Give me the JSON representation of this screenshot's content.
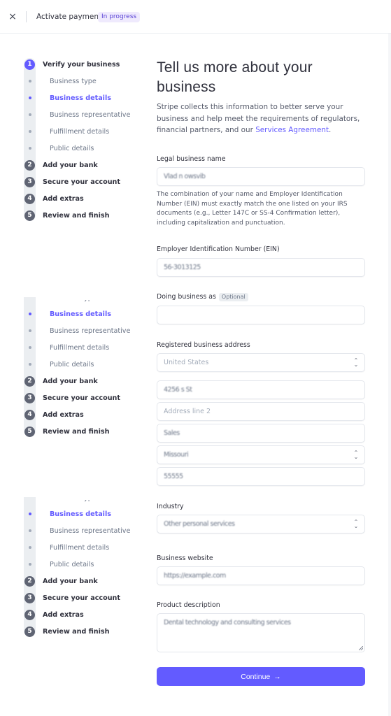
{
  "topbar": {
    "close_icon": "×",
    "title": "Activate payments",
    "status_badge": "In progress"
  },
  "stepper": {
    "steps": [
      {
        "number": "1",
        "label": "Verify your business",
        "active": true
      },
      {
        "number": "2",
        "label": "Add your bank",
        "active": false
      },
      {
        "number": "3",
        "label": "Secure your account",
        "active": false
      },
      {
        "number": "4",
        "label": "Add extras",
        "active": false
      },
      {
        "number": "5",
        "label": "Review and finish",
        "active": false
      }
    ],
    "substeps": [
      {
        "label": "Business type",
        "active": false
      },
      {
        "label": "Business details",
        "active": true
      },
      {
        "label": "Business representative",
        "active": false
      },
      {
        "label": "Fulfillment details",
        "active": false
      },
      {
        "label": "Public details",
        "active": false
      }
    ]
  },
  "main": {
    "title": "Tell us more about your business",
    "intro_text": "Stripe collects this information to better serve your business and help meet the requirements of regulators, financial partners, and our ",
    "intro_link": "Services Agreement",
    "intro_end": ".",
    "fields": {
      "legal_name": {
        "label": "Legal business name",
        "value": "Vlad n owsvib",
        "help": "The combination of your name and Employer Identification Number (EIN) must exactly match the one listed on your IRS documents (e.g., Letter 147C or SS-4 Confirmation letter), including capitalization and punctuation."
      },
      "ein": {
        "label": "Employer Identification Number (EIN)",
        "value": "56-3013125"
      },
      "dba": {
        "label": "Doing business as",
        "optional_badge": "Optional",
        "value": ""
      },
      "address": {
        "label": "Registered business address",
        "country": "United States",
        "line1": "4256 s St",
        "line2_placeholder": "Address line 2",
        "city": "Sales",
        "state": "Missouri",
        "zip": "55555"
      },
      "industry": {
        "label": "Industry",
        "value": "Other personal services"
      },
      "website": {
        "label": "Business website",
        "value": "https://example.com"
      },
      "product_description": {
        "label": "Product description",
        "value": "Dental technology and consulting services"
      }
    },
    "continue_label": "Continue",
    "continue_arrow": "→"
  },
  "colors": {
    "accent": "#635bff",
    "badge_bg": "#efeafd",
    "text": "#30313d",
    "muted": "#6c7688"
  }
}
